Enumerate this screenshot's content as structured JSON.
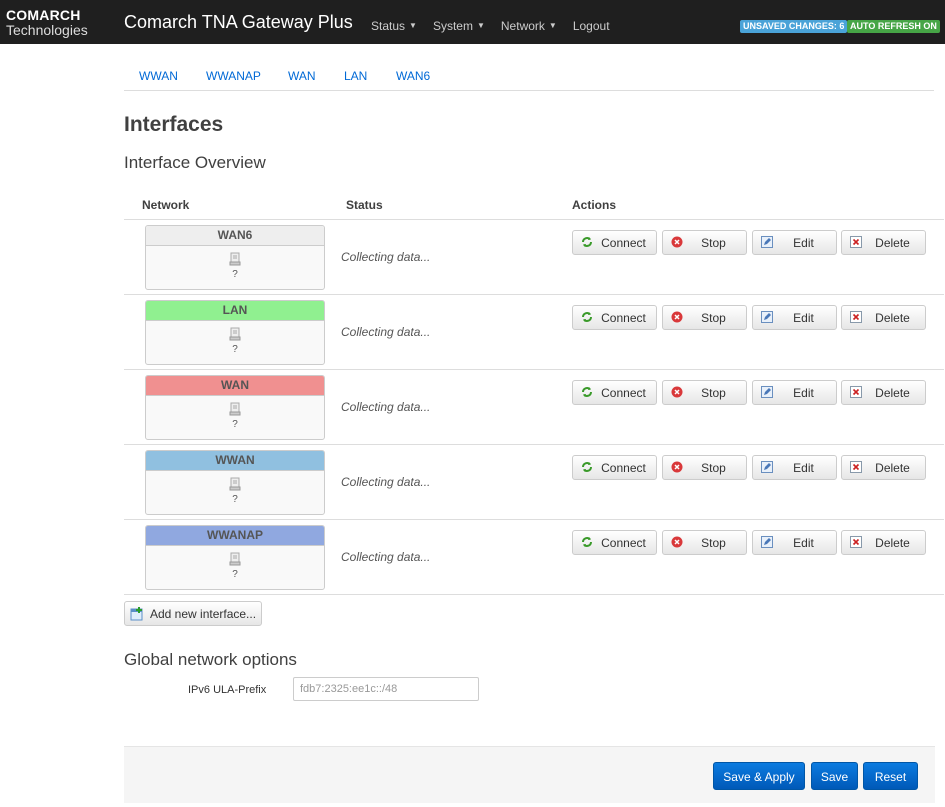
{
  "navbar": {
    "logo_line1": "COMARCH",
    "logo_line2": "Technologies",
    "brand": "Comarch TNA Gateway Plus",
    "menu": [
      {
        "label": "Status",
        "dropdown": true
      },
      {
        "label": "System",
        "dropdown": true
      },
      {
        "label": "Network",
        "dropdown": true
      },
      {
        "label": "Logout",
        "dropdown": false
      }
    ],
    "badge_unsaved": "UNSAVED CHANGES: 6",
    "badge_autorefresh": "AUTO REFRESH ON"
  },
  "tabs": [
    "WWAN",
    "WWANAP",
    "WAN",
    "LAN",
    "WAN6"
  ],
  "page_title": "Interfaces",
  "section_title": "Interface Overview",
  "table": {
    "headers": {
      "network": "Network",
      "status": "Status",
      "actions": "Actions"
    },
    "rows": [
      {
        "name": "WAN6",
        "color": "#eeeeee",
        "icon": "device-icon",
        "value": "?",
        "status": "Collecting data..."
      },
      {
        "name": "LAN",
        "color": "#90f090",
        "icon": "device-icon",
        "value": "?",
        "status": "Collecting data..."
      },
      {
        "name": "WAN",
        "color": "#f09090",
        "icon": "device-icon",
        "value": "?",
        "status": "Collecting data..."
      },
      {
        "name": "WWAN",
        "color": "#90c0e0",
        "icon": "device-icon",
        "value": "?",
        "status": "Collecting data..."
      },
      {
        "name": "WWANAP",
        "color": "#90a8e0",
        "icon": "device-icon",
        "value": "?",
        "status": "Collecting data..."
      }
    ],
    "actions": [
      {
        "label": "Connect",
        "icon": "reload-icon"
      },
      {
        "label": "Stop",
        "icon": "stop-icon"
      },
      {
        "label": "Edit",
        "icon": "edit-icon"
      },
      {
        "label": "Delete",
        "icon": "delete-icon"
      }
    ]
  },
  "add_interface_label": "Add new interface...",
  "global_options": {
    "title": "Global network options",
    "ula_label": "IPv6 ULA-Prefix",
    "ula_value": "",
    "ula_placeholder": "fdb7:2325:ee1c::/48"
  },
  "footer": {
    "save_apply": "Save & Apply",
    "save": "Save",
    "reset": "Reset"
  },
  "colors": {
    "accent": "#0069d6",
    "navbar": "#1f1f1f",
    "badge_unsaved": "#4aa3d8",
    "badge_auto": "#46a546"
  }
}
